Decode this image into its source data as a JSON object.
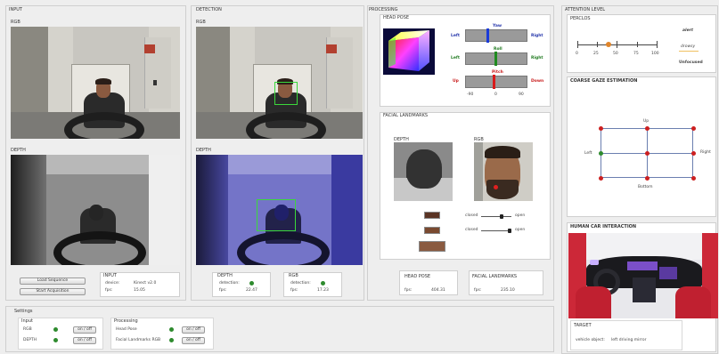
{
  "input": {
    "title": "INPUT",
    "rgb": "RGB",
    "depth": "DEPTH",
    "load_btn": "Load Sequence",
    "start_btn": "Start Acquisition",
    "info_title": "INPUT",
    "device_label": "device:",
    "device_val": "Kinect v2.0",
    "fps_label": "fps:",
    "fps_val": "15.05"
  },
  "detection": {
    "title": "DETECTION",
    "rgb": "RGB",
    "depth": "DEPTH",
    "depth_box": "DEPTH",
    "depth_det": "detection:",
    "depth_fps_label": "fps:",
    "depth_fps": "22.47",
    "rgb_box": "RGB",
    "rgb_det": "detection:",
    "rgb_fps_label": "fps:",
    "rgb_fps": "17.23"
  },
  "processing": {
    "title": "PROCESSING",
    "head_pose": "HEAD POSE",
    "yaw_label": "Yaw",
    "roll_label": "Roll",
    "pitch_label": "Pitch",
    "left1": "Left",
    "right1": "Right",
    "left2": "Left",
    "right2": "Right",
    "up": "Up",
    "down": "Down",
    "tick_neg": "-90",
    "tick_zero": "0",
    "tick_pos": "90",
    "facial_landmarks": "FACIAL LANDMARKS",
    "fl_depth": "DEPTH",
    "fl_rgb": "RGB",
    "closed1": "closed",
    "open1": "open",
    "closed2": "closed",
    "open2": "open",
    "hp_box": "HEAD POSE",
    "hp_fps_label": "fps:",
    "hp_fps": "404.31",
    "fl_box": "FACIAL LANDMARKS",
    "fl_fps_label": "fps:",
    "fl_fps": "235.10"
  },
  "attention": {
    "title": "ATTENTION LEVEL",
    "perclos": "PERCLOS",
    "ticks": [
      "0",
      "25",
      "50",
      "75",
      "100"
    ],
    "legend": {
      "alert": "alert",
      "drowsy": "drowsy",
      "unfocused": "Unfocused"
    },
    "perclos_value": 0.38
  },
  "gaze": {
    "title": "COARSE GAZE ESTIMATION",
    "up": "Up",
    "bottom": "Bottom",
    "left": "Left",
    "right": "Right"
  },
  "hci": {
    "title": "HUMAN CAR INTERACTION",
    "target_title": "TARGET",
    "vehicle_label": "vehicle object:",
    "vehicle_val": "left driving mirror"
  },
  "settings": {
    "title": "Settings",
    "input_group": "Input",
    "rgb": "RGB",
    "depth": "DEPTH",
    "toggle": "on / off",
    "processing_group": "Processing",
    "head_pose": "Head Pose",
    "facial_landmarks": "Facial Landmarks RGB"
  },
  "colors": {
    "yaw_marker": "#1a3ad8",
    "roll_marker": "#1f8a1f",
    "pitch_marker": "#d81a1a",
    "dot_green": "#2e8b2e",
    "dot_red": "#cc2020",
    "gaze_box": "#6b7fb0",
    "perclos_marker": "#e0852a",
    "drowsy_line": "#f0c060"
  }
}
